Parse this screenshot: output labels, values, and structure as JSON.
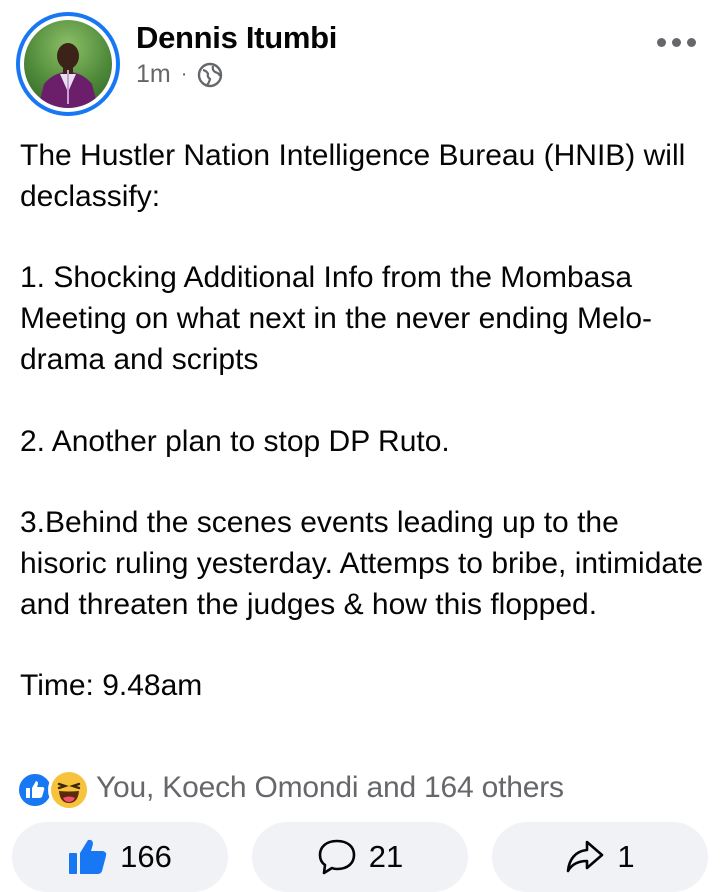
{
  "post": {
    "author": "Dennis Itumbi",
    "time": "1m",
    "separator": "·",
    "privacy_icon": "globe-icon",
    "more_icon": "more-options-icon",
    "text": "The Hustler Nation Intelligence Bureau (HNIB) will declassify:\n\n1. Shocking Additional Info from the Mombasa Meeting on what next in the never ending Melo-drama and scripts\n\n2. Another plan to stop DP Ruto.\n\n3.Behind the scenes events leading up to the hisoric ruling yesterday. Attemps to bribe, intimidate and threaten the judges & how this flopped.\n\nTime: 9.48am"
  },
  "reactions": {
    "icons": [
      "like-reaction-icon",
      "haha-reaction-icon"
    ],
    "summary": "You, Koech Omondi and 164 others"
  },
  "actions": {
    "like_count": "166",
    "comment_count": "21",
    "share_count": "1"
  },
  "colors": {
    "accent": "#1877f2",
    "secondary_text": "#65676b",
    "button_bg": "#f0f2f5",
    "haha": "#f7c23c"
  }
}
